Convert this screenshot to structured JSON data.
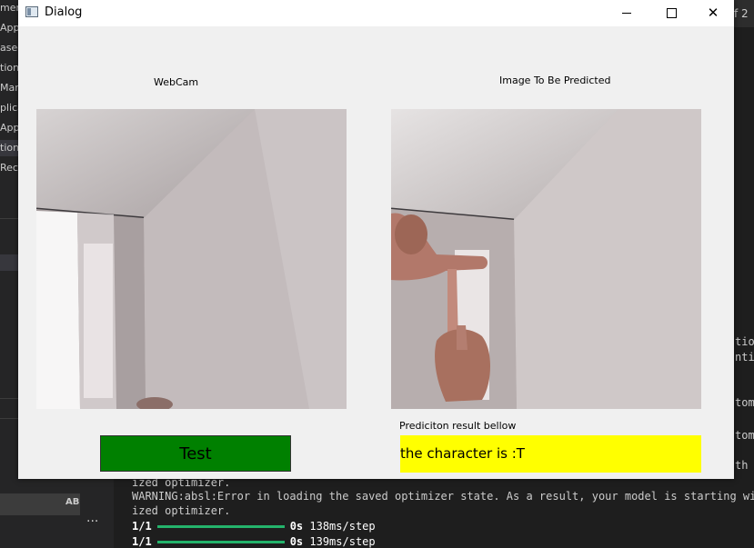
{
  "background": {
    "sidebar_items": [
      {
        "label": "men"
      },
      {
        "label": "Appl"
      },
      {
        "label": "ased"
      },
      {
        "label": "tion"
      },
      {
        "label": "Mar"
      },
      {
        "label": "plica"
      },
      {
        "label": "App"
      },
      {
        "label": "tion"
      },
      {
        "label": "Rec"
      }
    ],
    "tab_fragment": "f 2",
    "right_fragments": [
      "tion",
      "ntia",
      "tom",
      "tom",
      "th"
    ],
    "input_badge": "AB",
    "more_glyph": "···",
    "terminal": {
      "line1": "ized optimizer.",
      "line2": "WARNING:absl:Error in loading the saved optimizer state. As a result, your model is starting with",
      "line3": "ized optimizer.",
      "steps": [
        {
          "count": "1/1",
          "time": "0s",
          "rate": "138ms/step"
        },
        {
          "count": "1/1",
          "time": "0s",
          "rate": "139ms/step"
        }
      ],
      "progress_color": "#24b36b"
    }
  },
  "dialog": {
    "title": "Dialog",
    "webcam_label": "WebCam",
    "predict_label": "Image To Be Predicted",
    "result_label": "Prediciton result bellow",
    "test_button": "Test",
    "result_text": "the character is :T",
    "colors": {
      "test_button": "#008000",
      "result_box": "#ffff00"
    }
  }
}
